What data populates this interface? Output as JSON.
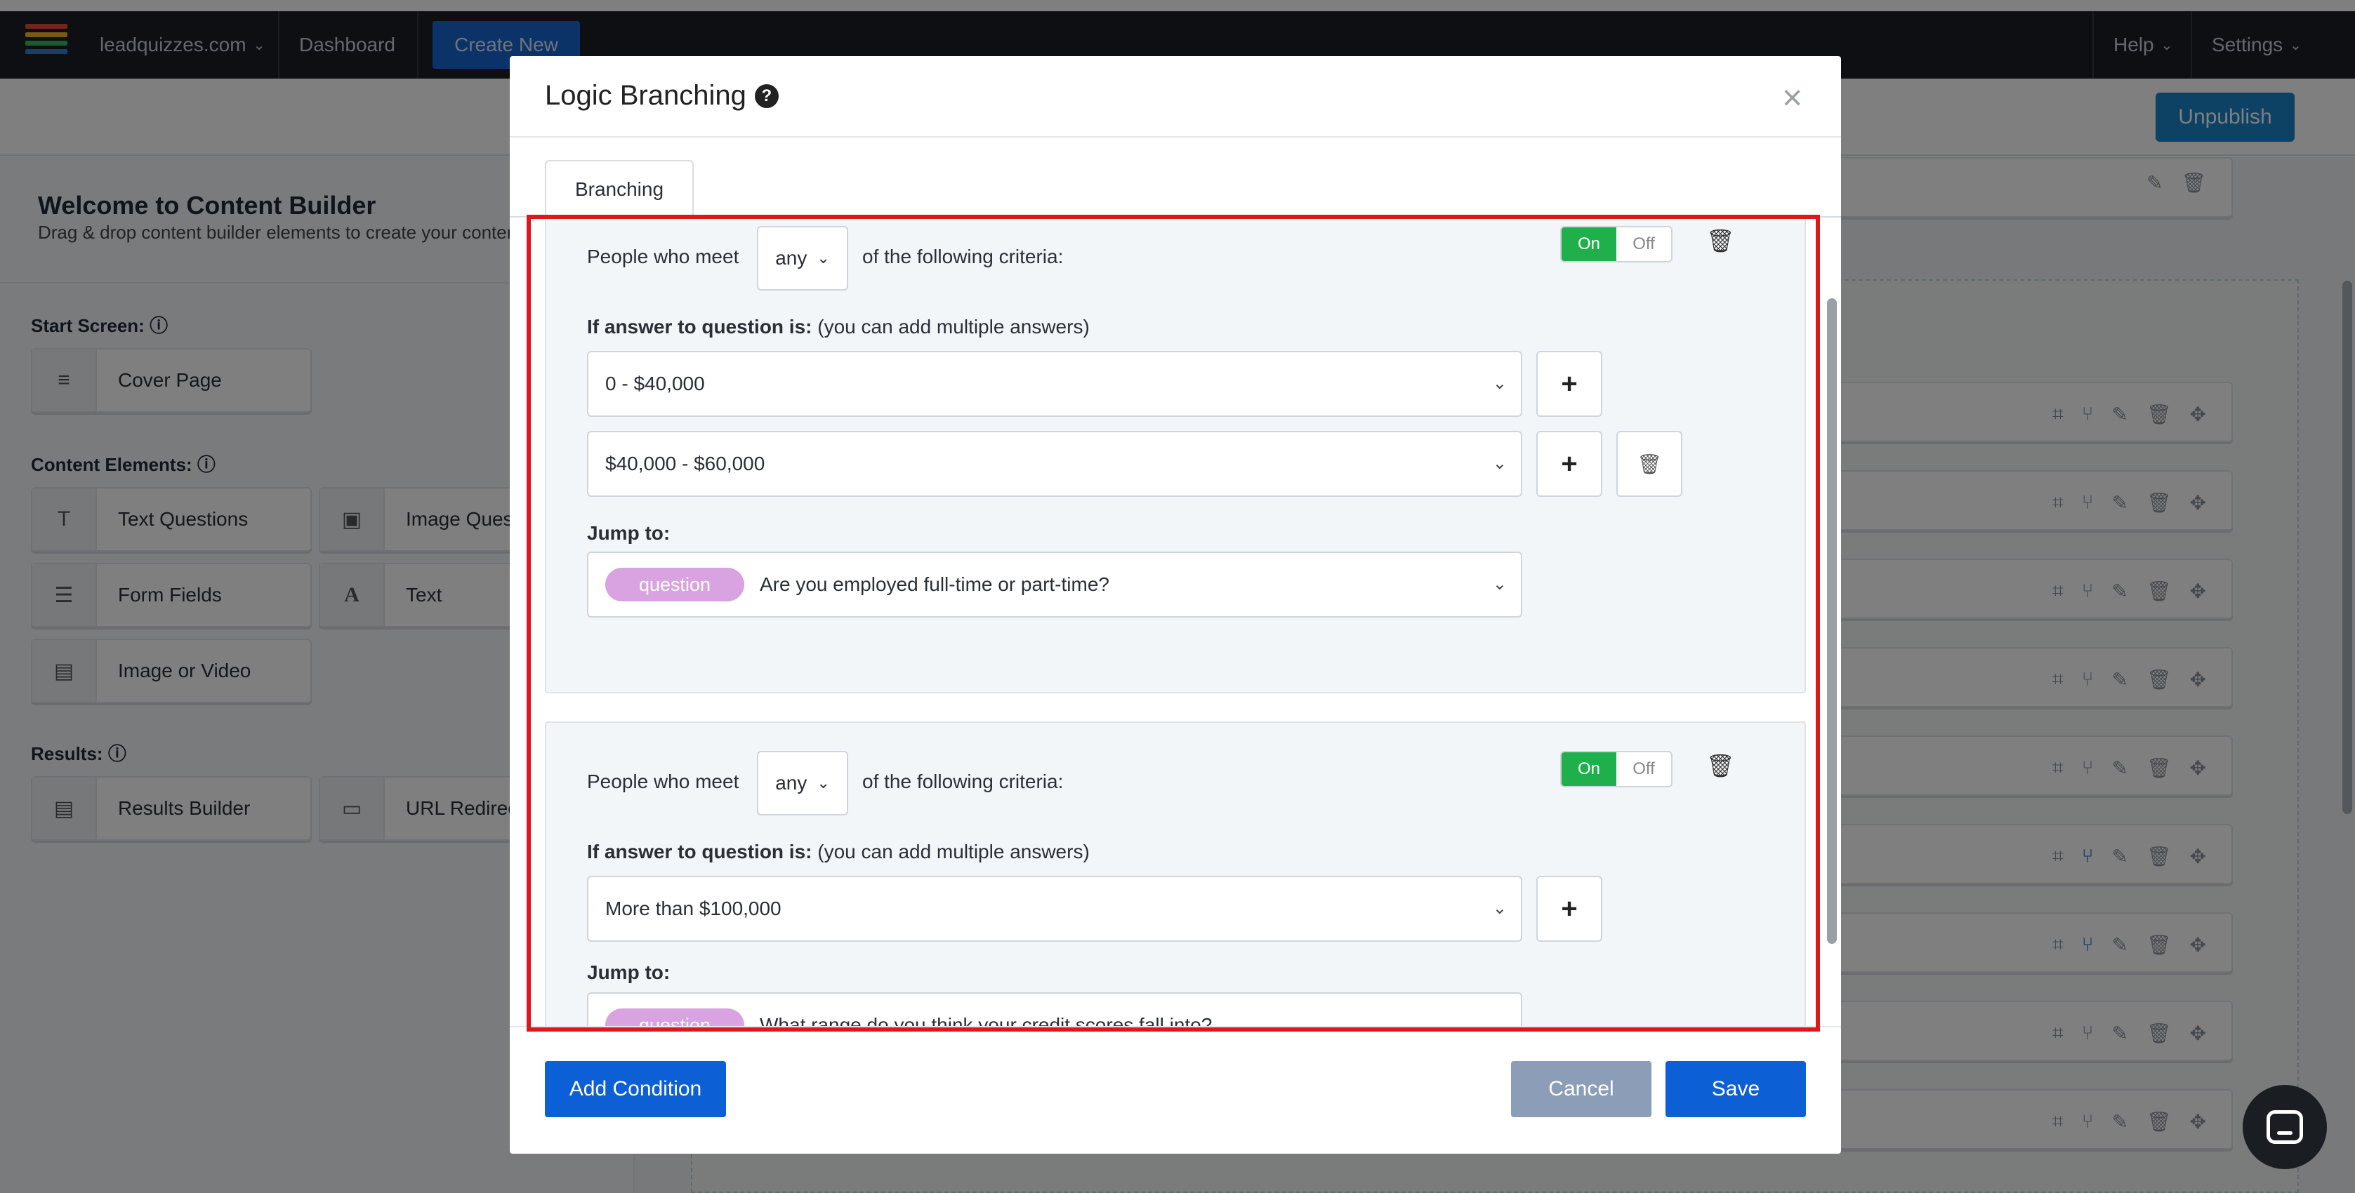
{
  "topnav": {
    "site": "leadquizzes.com",
    "dashboard": "Dashboard",
    "create_new": "Create New",
    "help": "Help",
    "settings": "Settings"
  },
  "subbar": {
    "unpublish": "Unpublish"
  },
  "sidebar": {
    "welcome_title": "Welcome to Content Builder",
    "welcome_sub": "Drag & drop content builder elements to create your content",
    "start_screen_label": "Start Screen:",
    "content_elements_label": "Content Elements:",
    "results_label": "Results:",
    "cover_page": "Cover Page",
    "text_questions": "Text Questions",
    "image_questions": "Image Questions",
    "form_fields": "Form Fields",
    "text": "Text",
    "image_or_video": "Image or Video",
    "results_builder": "Results Builder",
    "url_redirect": "URL Redirect"
  },
  "modal": {
    "title": "Logic Branching",
    "tab": "Branching",
    "conditions": [
      {
        "people_who_meet": "People who meet",
        "match": "any",
        "of_criteria": "of the following criteria:",
        "toggle_on": "On",
        "toggle_off": "Off",
        "if_answer_bold": "If answer to question is:",
        "if_answer_note": "(you can add multiple answers)",
        "answers": [
          "0 - $40,000",
          "$40,000 - $60,000"
        ],
        "jump_to": "Jump to:",
        "jump_tag": "question",
        "jump_target": "Are you employed full-time or part-time?"
      },
      {
        "people_who_meet": "People who meet",
        "match": "any",
        "of_criteria": "of the following criteria:",
        "toggle_on": "On",
        "toggle_off": "Off",
        "if_answer_bold": "If answer to question is:",
        "if_answer_note": "(you can add multiple answers)",
        "answers": [
          "More than $100,000"
        ],
        "jump_to": "Jump to:",
        "jump_tag": "question",
        "jump_target": "What range do you think your credit scores fall into?"
      }
    ],
    "add_condition": "Add Condition",
    "cancel": "Cancel",
    "save": "Save"
  },
  "colors": {
    "primary": "#0d5fd6",
    "toggle_on": "#20b04b",
    "pill": "#d9a2e0",
    "highlight": "#e0161f",
    "nav_bg": "#1a1f26"
  }
}
